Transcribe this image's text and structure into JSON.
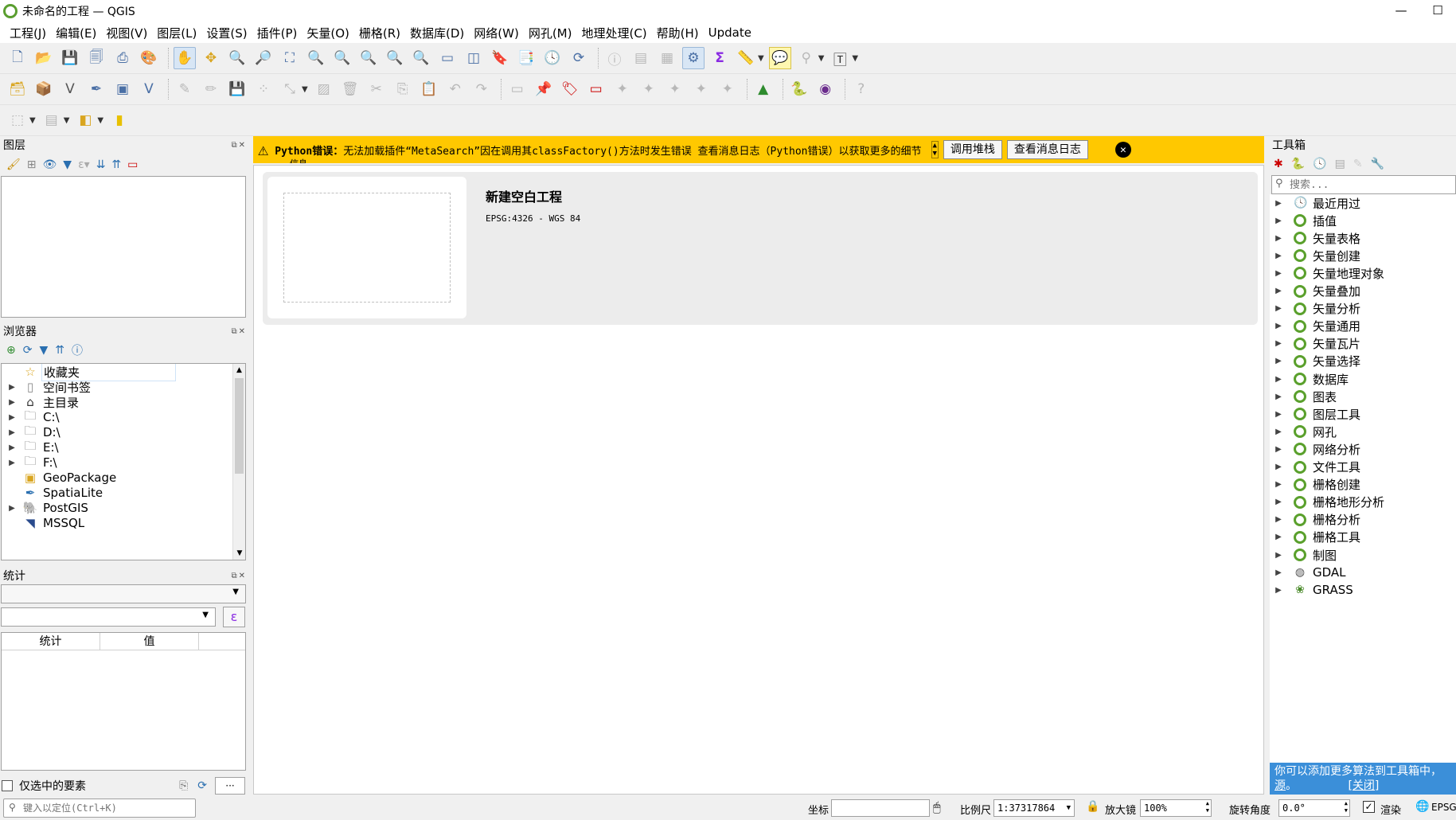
{
  "window": {
    "title": "未命名的工程 — QGIS",
    "controls": [
      "—",
      "☐"
    ]
  },
  "menu": [
    "工程(J)",
    "编辑(E)",
    "视图(V)",
    "图层(L)",
    "设置(S)",
    "插件(P)",
    "矢量(O)",
    "栅格(R)",
    "数据库(D)",
    "网络(W)",
    "网孔(M)",
    "地理处理(C)",
    "帮助(H)",
    "Update"
  ],
  "layers_panel": {
    "title": "图层"
  },
  "browser_panel": {
    "title": "浏览器",
    "items": [
      {
        "label": "收藏夹",
        "icon": "star-icon",
        "expandable": false
      },
      {
        "label": "空间书签",
        "icon": "bookmark-icon",
        "expandable": true
      },
      {
        "label": "主目录",
        "icon": "home-icon",
        "expandable": true
      },
      {
        "label": "C:\\",
        "icon": "folder-icon",
        "expandable": true
      },
      {
        "label": "D:\\",
        "icon": "folder-icon",
        "expandable": true
      },
      {
        "label": "E:\\",
        "icon": "folder-icon",
        "expandable": true
      },
      {
        "label": "F:\\",
        "icon": "folder-icon",
        "expandable": true
      },
      {
        "label": "GeoPackage",
        "icon": "geopackage-icon",
        "expandable": false
      },
      {
        "label": "SpatiaLite",
        "icon": "spatialite-icon",
        "expandable": false
      },
      {
        "label": "PostGIS",
        "icon": "postgis-icon",
        "expandable": true
      },
      {
        "label": "MSSQL",
        "icon": "mssql-icon",
        "expandable": false
      }
    ]
  },
  "stats_panel": {
    "title": "统计",
    "col_stat": "统计",
    "col_value": "值",
    "selected_only": "仅选中的要素",
    "epsilon": "ε",
    "more": "···"
  },
  "message_bar": {
    "prefix": "Python错误：",
    "text": "无法加载插件“MetaSearch”因在调用其classFactory()方法时发生错误 查看消息日志（Python错误）以获取更多的细节",
    "overflow": "信息",
    "btn_stack": "调用堆栈",
    "btn_log": "查看消息日志"
  },
  "recent_project": {
    "title": "新建空白工程",
    "crs": "EPSG:4326 - WGS 84"
  },
  "toolbox": {
    "title": "工具箱",
    "search_placeholder": "搜索...",
    "items": [
      {
        "label": "最近用过",
        "icon": "clock-icon"
      },
      {
        "label": "插值",
        "icon": "qgis-icon"
      },
      {
        "label": "矢量表格",
        "icon": "qgis-icon"
      },
      {
        "label": "矢量创建",
        "icon": "qgis-icon"
      },
      {
        "label": "矢量地理对象",
        "icon": "qgis-icon"
      },
      {
        "label": "矢量叠加",
        "icon": "qgis-icon"
      },
      {
        "label": "矢量分析",
        "icon": "qgis-icon"
      },
      {
        "label": "矢量通用",
        "icon": "qgis-icon"
      },
      {
        "label": "矢量瓦片",
        "icon": "qgis-icon"
      },
      {
        "label": "矢量选择",
        "icon": "qgis-icon"
      },
      {
        "label": "数据库",
        "icon": "qgis-icon"
      },
      {
        "label": "图表",
        "icon": "qgis-icon"
      },
      {
        "label": "图层工具",
        "icon": "qgis-icon"
      },
      {
        "label": "网孔",
        "icon": "qgis-icon"
      },
      {
        "label": "网络分析",
        "icon": "qgis-icon"
      },
      {
        "label": "文件工具",
        "icon": "qgis-icon"
      },
      {
        "label": "栅格创建",
        "icon": "qgis-icon"
      },
      {
        "label": "栅格地形分析",
        "icon": "qgis-icon"
      },
      {
        "label": "栅格分析",
        "icon": "qgis-icon"
      },
      {
        "label": "栅格工具",
        "icon": "qgis-icon"
      },
      {
        "label": "制图",
        "icon": "qgis-icon"
      },
      {
        "label": "GDAL",
        "icon": "gdal-icon"
      },
      {
        "label": "GRASS",
        "icon": "grass-icon"
      }
    ],
    "hint_text": "你可以添加更多算法到工具箱中，",
    "hint_link": "源",
    "hint_close": "[关闭]"
  },
  "locator": {
    "placeholder": "键入以定位(Ctrl+K)"
  },
  "status": {
    "coord_label": "坐标",
    "coord_value": "",
    "scale_label": "比例尺",
    "scale_value": "1:37317864",
    "magnifier_label": "放大镜",
    "magnifier_value": "100%",
    "rotation_label": "旋转角度",
    "rotation_value": "0.0°",
    "render_label": "渲染",
    "crs": "EPSG"
  }
}
